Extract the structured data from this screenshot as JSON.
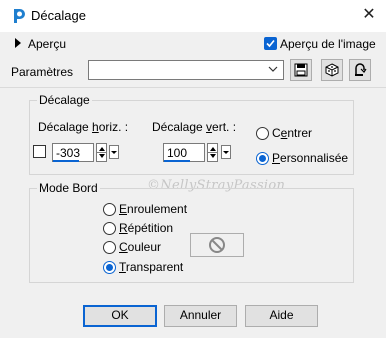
{
  "window": {
    "title": "Décalage",
    "close_glyph": "✕"
  },
  "apercu": {
    "label": "Aperçu",
    "image_checkbox_label": "Aperçu de l'image",
    "image_checked": true
  },
  "params": {
    "label": "Paramètres",
    "value": ""
  },
  "offset_group": {
    "title": "Décalage",
    "horiz": {
      "label_pre": "Décalage ",
      "label_ul": "h",
      "label_post": "oriz. :",
      "value": "-303"
    },
    "vert": {
      "label_pre": "Décalage ",
      "label_ul": "v",
      "label_post": "ert. :",
      "value": "100"
    },
    "center": {
      "pre": "C",
      "ul": "e",
      "post": "ntrer"
    },
    "custom": {
      "ul": "P",
      "post": "ersonnalisée"
    },
    "selected": "custom"
  },
  "edge_group": {
    "title": "Mode Bord",
    "options": [
      {
        "ul": "E",
        "post": "nroulement",
        "selected": false
      },
      {
        "ul": "R",
        "post": "épétition",
        "selected": false
      },
      {
        "ul": "C",
        "post": "ouleur",
        "selected": false
      },
      {
        "ul": "T",
        "post": "ransparent",
        "selected": true
      }
    ]
  },
  "watermark": "©NellyStrayPassion",
  "buttons": {
    "ok": "OK",
    "cancel": "Annuler",
    "help": "Aide"
  },
  "colors": {
    "accent": "#0a64d2",
    "window_bg": "#f0f0f0",
    "titlebar_bg": "#ffffff"
  },
  "icons": {
    "app": "paintshop-pro-icon",
    "toolbar": [
      "save-preset-icon",
      "randomize-dice-icon",
      "reset-icon"
    ]
  }
}
